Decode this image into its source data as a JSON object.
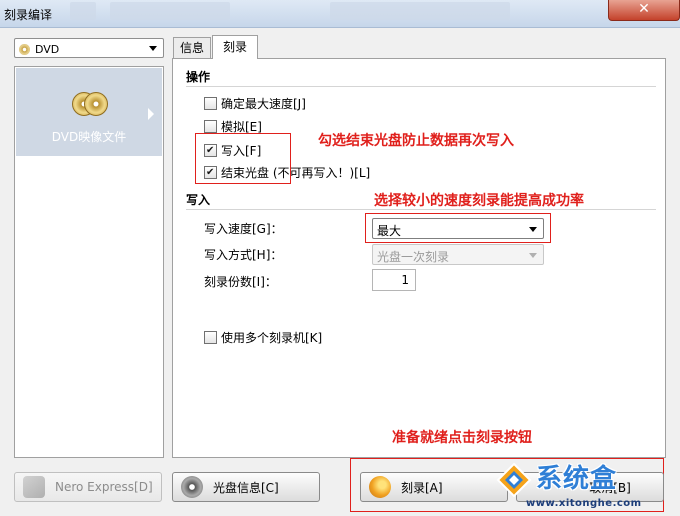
{
  "window": {
    "title": "刻录编译",
    "close_label": "✕"
  },
  "left": {
    "dropdown_value": "DVD",
    "item_label": "DVD映像文件"
  },
  "tabs": [
    {
      "label": "信息"
    },
    {
      "label": "刻录"
    }
  ],
  "operations": {
    "heading": "操作",
    "options": [
      {
        "label": "确定最大速度[J]",
        "checked": false
      },
      {
        "label": "模拟[E]",
        "checked": false
      },
      {
        "label": "写入[F]",
        "checked": true
      },
      {
        "label": "结束光盘 (不可再写入！)[L]",
        "checked": true
      }
    ]
  },
  "write": {
    "heading": "写入",
    "speed_label": "写入速度[G]：",
    "speed_value": "最大",
    "method_label": "写入方式[H]：",
    "method_value": "光盘一次刻录",
    "copies_label": "刻录份数[I]：",
    "copies_value": "1",
    "multi_label": "使用多个刻录机[K]"
  },
  "annotations": {
    "finalize": "勾选结束光盘防止数据再次写入",
    "speed": "选择较小的速度刻录能提高成功率",
    "ready": "准备就绪点击刻录按钮"
  },
  "buttons": {
    "nero_express": "Nero Express[D]",
    "disc_info": "光盘信息[C]",
    "burn": "刻录[A]",
    "cancel": "取消[B]"
  },
  "watermark": {
    "name": "系统盒",
    "url": "www.xitonghe.com"
  },
  "colors": {
    "annotation": "#e0201c",
    "watermark": "#2f7fd6",
    "left_item_bg": "#cfd8e4"
  }
}
